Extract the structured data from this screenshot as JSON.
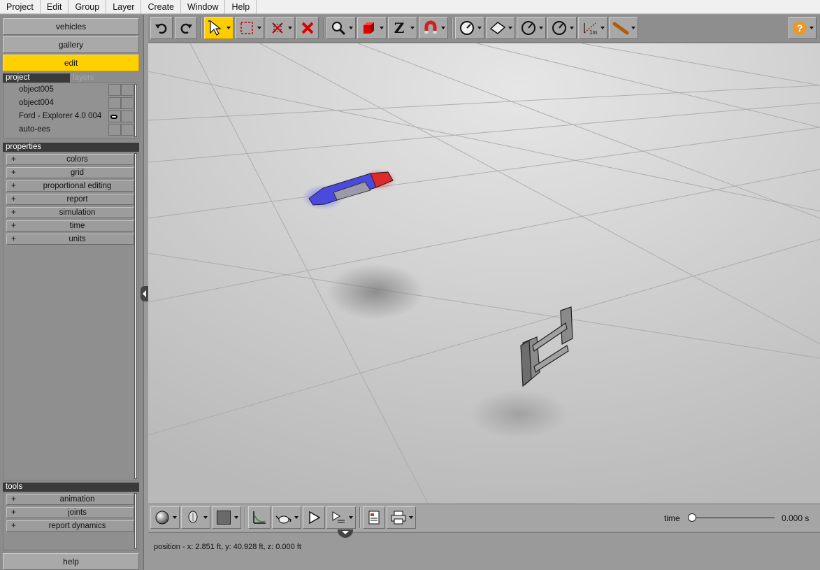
{
  "menu": [
    "Project",
    "Edit",
    "Group",
    "Layer",
    "Create",
    "Window",
    "Help"
  ],
  "nav": {
    "vehicles": "vehicles",
    "gallery": "gallery",
    "edit": "edit",
    "help": "help"
  },
  "project_tabs": {
    "project": "project",
    "layers": "layers"
  },
  "project_items": [
    {
      "name": "object005",
      "visibility_icon": false
    },
    {
      "name": "object004",
      "visibility_icon": false
    },
    {
      "name": "Ford - Explorer 4.0 004",
      "visibility_icon": true
    },
    {
      "name": "auto-ees",
      "visibility_icon": false
    }
  ],
  "properties": {
    "header": "properties",
    "items": [
      "colors",
      "grid",
      "proportional editing",
      "report",
      "simulation",
      "time",
      "units"
    ]
  },
  "tools": {
    "header": "tools",
    "items": [
      "animation",
      "joints",
      "report dynamics"
    ]
  },
  "expand_symbol": "+",
  "toolbar_icons": [
    "undo-icon",
    "redo-icon",
    "select-arrow-icon",
    "selection-box-icon",
    "scissor-icon",
    "delete-icon",
    "zoom-icon",
    "cube-icon",
    "z-axis-icon",
    "magnet-icon",
    "gauge-icon",
    "surface-icon",
    "angle-icon",
    "angle-icon",
    "distance-measure-icon",
    "bat-icon",
    "help-icon"
  ],
  "distance_label": "1m",
  "z_label": "Z",
  "help_symbol": "?",
  "time": {
    "label": "time",
    "value": "0.000 s",
    "position": 0
  },
  "status": {
    "position": "position - x: 2.851 ft, y: 40.928 ft, z: 0.000 ft"
  },
  "colors": {
    "accent": "#ffd000",
    "panel": "#8c8c8c",
    "header": "#3a3a3a"
  }
}
